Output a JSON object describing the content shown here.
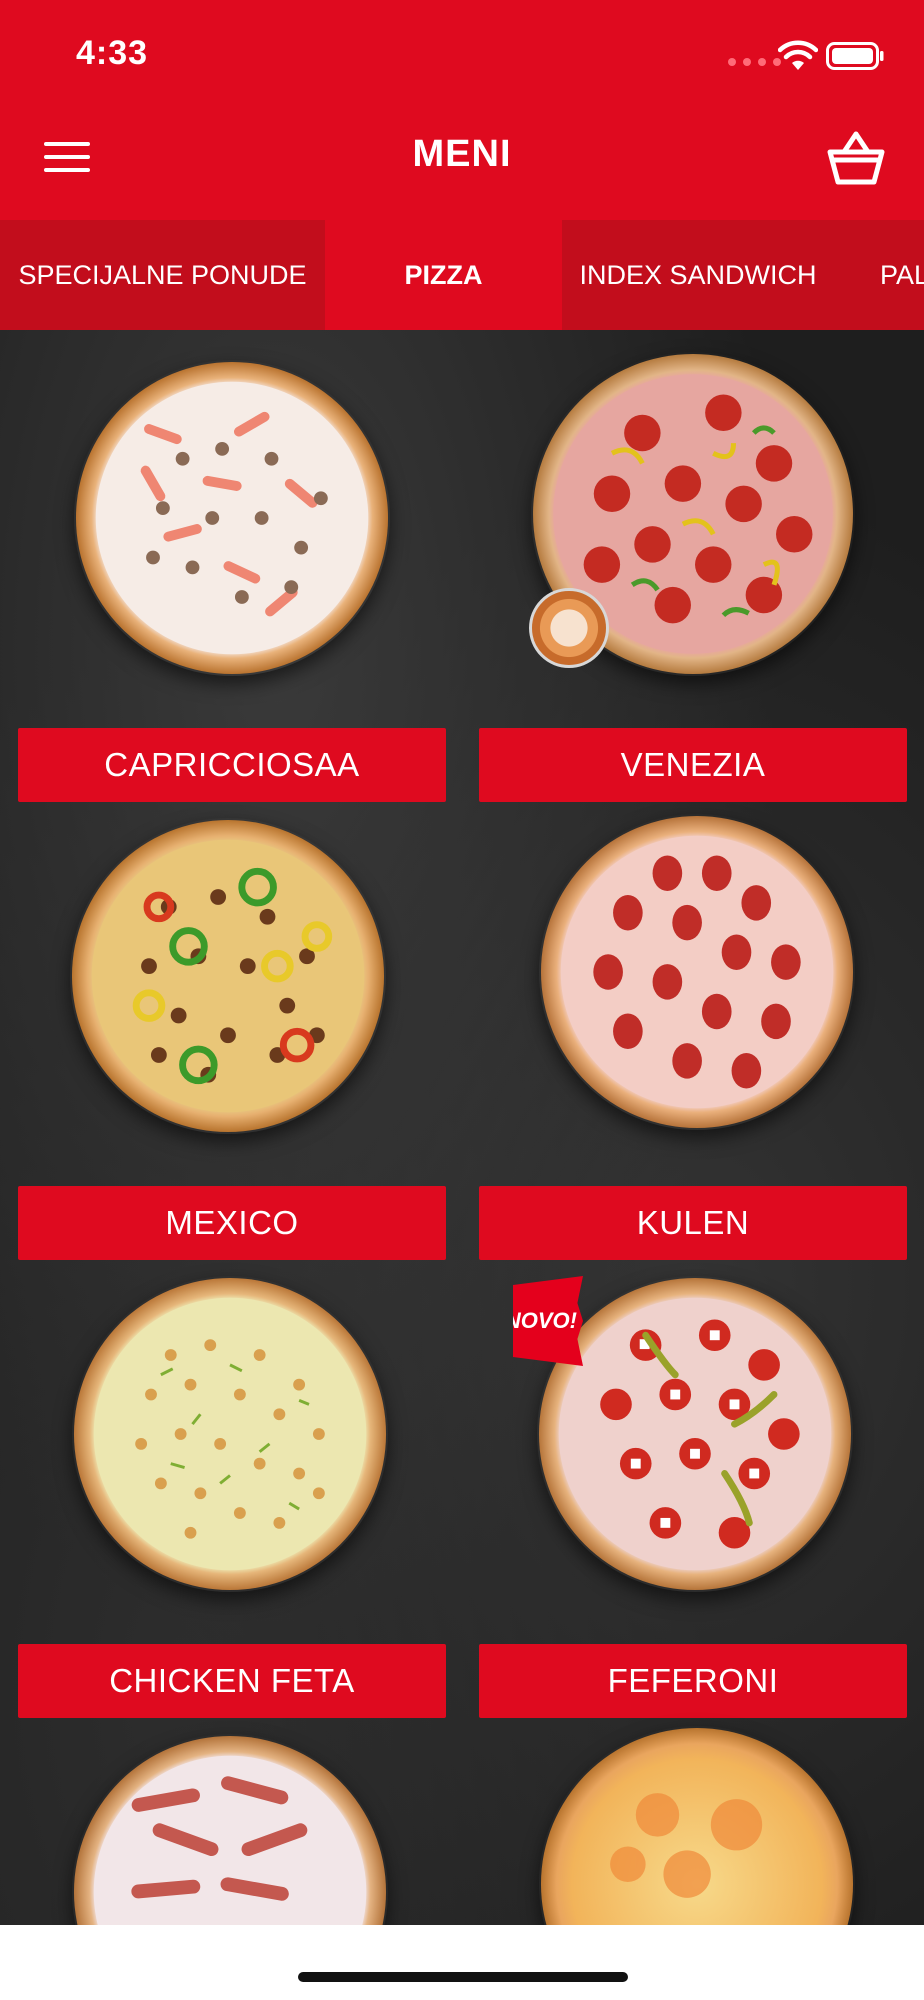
{
  "status_bar": {
    "time": "4:33"
  },
  "header": {
    "title": "MENI"
  },
  "tabs": [
    {
      "label": "SPECIJALNE PONUDE",
      "active": false
    },
    {
      "label": "PIZZA",
      "active": true
    },
    {
      "label": "INDEX SANDWICH",
      "active": false
    },
    {
      "label": "PAL",
      "active": false
    }
  ],
  "products": [
    {
      "name": "CAPRICCIOSAA",
      "topping": "mushroom"
    },
    {
      "name": "VENEZIA",
      "topping": "salami-peppers",
      "badge_icon": "thumbnail-icon"
    },
    {
      "name": "MEXICO",
      "topping": "minced-meat-peppers"
    },
    {
      "name": "KULEN",
      "topping": "kulen-salami"
    },
    {
      "name": "CHICKEN FETA",
      "topping": "chicken"
    },
    {
      "name": "FEFERONI",
      "topping": "pepperoni-feta",
      "badge": "NOVO!"
    },
    {
      "name": "",
      "topping": "bacon"
    },
    {
      "name": "",
      "topping": "cheese"
    }
  ],
  "colors": {
    "brand_red": "#df0a1f",
    "tab_inactive": "#c20d1c",
    "background": "#1e1e1e"
  }
}
